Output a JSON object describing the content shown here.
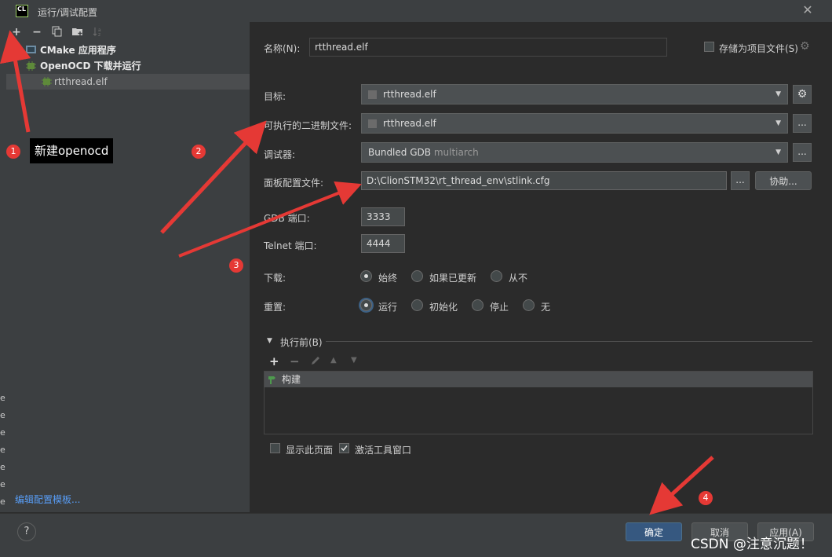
{
  "window": {
    "title": "运行/调试配置",
    "close_icon": "close-icon"
  },
  "left_toolbar": [
    {
      "name": "add-icon",
      "glyph": "+"
    },
    {
      "name": "remove-icon",
      "glyph": "−"
    },
    {
      "name": "copy-icon",
      "glyph": "⧉"
    },
    {
      "name": "folder-add-icon",
      "glyph": "▣"
    },
    {
      "name": "sort-icon",
      "glyph": "↓"
    }
  ],
  "tree": {
    "items": [
      {
        "label": "CMake 应用程序",
        "bold": true
      },
      {
        "label": "OpenOCD 下载并运行",
        "bold": true
      },
      {
        "label": "rtthread.elf",
        "selected": true
      }
    ]
  },
  "edit_templates_link": "编辑配置模板...",
  "form": {
    "name_label": "名称(N):",
    "name_value": "rtthread.elf",
    "store_as_project_file": "存储为项目文件(S)",
    "target_label": "目标:",
    "target_value": "rtthread.elf",
    "executable_label": "可执行的二进制文件:",
    "executable_value": "rtthread.elf",
    "debugger_label": "调试器:",
    "debugger_value": "Bundled GDB",
    "debugger_suffix": "multiarch",
    "board_config_label": "面板配置文件:",
    "board_config_value": "D:\\ClionSTM32\\rt_thread_env\\stlink.cfg",
    "browse_label": "...",
    "assist_label": "协助...",
    "gdb_port_label": "GDB 端口:",
    "gdb_port_value": "3333",
    "telnet_port_label": "Telnet 端口:",
    "telnet_port_value": "4444",
    "download_label": "下载:",
    "download_options": [
      "始终",
      "如果已更新",
      "从不"
    ],
    "download_selected": "始终",
    "reset_label": "重置:",
    "reset_options": [
      "运行",
      "初始化",
      "停止",
      "无"
    ],
    "reset_selected": "运行",
    "before_launch_label": "执行前(B)",
    "before_launch_item": "构建",
    "show_page_label": "显示此页面",
    "activate_tool_window_label": "激活工具窗口",
    "show_page_checked": false,
    "activate_tool_window_checked": true
  },
  "buttons": {
    "ok": "确定",
    "cancel": "取消",
    "apply": "应用(A)",
    "help": "?"
  },
  "annotations": {
    "n1": "1",
    "n2": "2",
    "n3": "3",
    "n4": "4",
    "tooltip": "新建openocd"
  },
  "left_strip_letters": [
    "e",
    "e",
    "e",
    "e",
    "e",
    "e",
    "e",
    "e",
    "e"
  ],
  "watermark": "CSDN @注意沉题！",
  "colors": {
    "accent": "#365880",
    "annotation": "#e53935",
    "link": "#589df6"
  }
}
